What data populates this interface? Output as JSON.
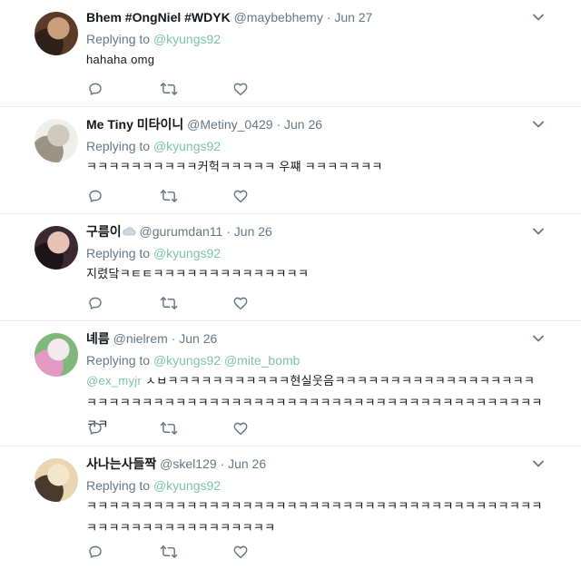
{
  "tweets": [
    {
      "name": "Bhem #OngNiel #WDYK",
      "handle": "@maybebhemy",
      "time": "Jun 27",
      "replying_label": "Replying to",
      "mentions": "@kyungs92",
      "text_mention": "",
      "text": "hahaha omg",
      "avatar_colors": [
        "#5b3a2a",
        "#c9a07a",
        "#2e2118"
      ]
    },
    {
      "name": "Me Tiny 미타이니",
      "handle": "@Metiny_0429",
      "time": "Jun 26",
      "replying_label": "Replying to",
      "mentions": "@kyungs92",
      "text_mention": "",
      "text": "ㅋㅋㅋㅋㅋㅋㅋㅋㅋㅋ커헉ㅋㅋㅋㅋㅋ 우쨰 ㅋㅋㅋㅋㅋㅋㅋ",
      "avatar_colors": [
        "#efeee9",
        "#cfcabd",
        "#9b9484"
      ]
    },
    {
      "name": "구름이",
      "name_icon": "cloud-emoji",
      "handle": "@gurumdan11",
      "time": "Jun 26",
      "replying_label": "Replying to",
      "mentions": "@kyungs92",
      "text_mention": "",
      "text": "지렸닼ㅋㅌㅌㅋㅋㅋㅋㅋㅋㅋㅋㅋㅋㅋㅋㅋㅋ",
      "avatar_colors": [
        "#3a2a2f",
        "#e8c2b5",
        "#1c1416"
      ]
    },
    {
      "name": "녜름",
      "handle": "@nielrem",
      "time": "Jun 26",
      "replying_label": "Replying to",
      "mentions": "@kyungs92 @mite_bomb",
      "text_mention": "@ex_myjr",
      "text": " ㅅㅂㅋㅋㅋㅋㅋㅋㅋㅋㅋㅋㅋ현실웃음ㅋㅋㅋㅋㅋㅋㅋㅋㅋㅋㅋㅋㅋㅋㅋㅋㅋㅋㅋㅋㅋㅋㅋㅋㅋㅋㅋㅋㅋㅋㅋㅋㅋㅋㅋㅋㅋㅋㅋㅋㅋㅋㅋㅋㅋㅋㅋㅋㅋㅋㅋㅋㅋㅋㅋㅋㅋㅋㅋㅋㅋ",
      "avatar_colors": [
        "#7fb87a",
        "#f3e9ea",
        "#e39ac0"
      ]
    },
    {
      "name": "사나는사들짝",
      "handle": "@skel129",
      "time": "Jun 26",
      "replying_label": "Replying to",
      "mentions": "@kyungs92",
      "text_mention": "",
      "text": "ㅋㅋㅋㅋㅋㅋㅋㅋㅋㅋㅋㅋㅋㅋㅋㅋㅋㅋㅋㅋㅋㅋㅋㅋㅋㅋㅋㅋㅋㅋㅋㅋㅋㅋㅋㅋㅋㅋㅋㅋㅋㅋㅋㅋㅋㅋㅋㅋㅋㅋㅋㅋㅋㅋㅋㅋㅋㅋ",
      "avatar_colors": [
        "#e9d5b0",
        "#f4e6c8",
        "#4a3a2c"
      ]
    }
  ],
  "icons": {
    "reply": "reply-icon",
    "retweet": "retweet-icon",
    "like": "heart-icon",
    "more": "chevron-down-icon"
  },
  "colors": {
    "mention": "#7cc4a6",
    "icon": "#657786",
    "divider": "#e6ecf0"
  }
}
